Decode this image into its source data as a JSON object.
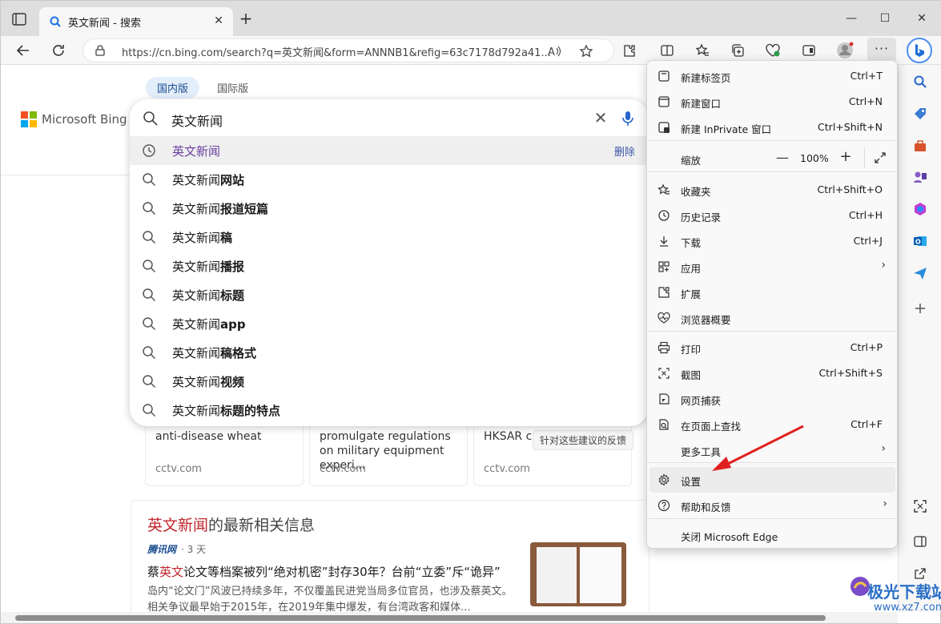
{
  "tab": {
    "title": "英文新闻 - 搜索"
  },
  "address": {
    "url": "https://cn.bing.com/search?q=英文新闻&form=ANNNB1&refig=63c7178d792a41..."
  },
  "page": {
    "scopes": [
      "国内版",
      "国际版"
    ],
    "brand": "Microsoft Bing",
    "search": {
      "query": "英文新闻",
      "suggestions": [
        {
          "prefix": "英文新闻",
          "suffix": "",
          "delete": "删除"
        },
        {
          "prefix": "英文新闻",
          "suffix": "网站"
        },
        {
          "prefix": "英文新闻",
          "suffix": "报道短篇"
        },
        {
          "prefix": "英文新闻",
          "suffix": "稿"
        },
        {
          "prefix": "英文新闻",
          "suffix": "播报"
        },
        {
          "prefix": "英文新闻",
          "suffix": "标题"
        },
        {
          "prefix": "英文新闻",
          "suffix": "app"
        },
        {
          "prefix": "英文新闻",
          "suffix": "稿格式"
        },
        {
          "prefix": "英文新闻",
          "suffix": "视频"
        },
        {
          "prefix": "英文新闻",
          "suffix": "标题的特点"
        }
      ]
    },
    "cards": [
      {
        "title": "anti-disease wheat",
        "source": "cctv.com"
      },
      {
        "title": "promulgate regulations on military equipment experi...",
        "source": "cctv.com"
      },
      {
        "title": "HKSAR c 19 caseloa",
        "source": "cctv.com"
      }
    ],
    "feedback": "针对这些建议的反馈",
    "news": {
      "heading_hl": "英文新闻",
      "heading_rest": "的最新相关信息",
      "source_logo": "腾讯网",
      "age": "· 3 天",
      "title_pre": "蔡",
      "title_hl": "英文",
      "title_post": "论文等档案被列“绝对机密”封存30年？台前“立委”斥“诡异”",
      "snippet": "岛内“论文门”风波已持续多年，不仅覆盖民进党当局多位官员，也涉及蔡英文。相关争议最早始于2015年，在2019年集中爆发，有台湾政客和媒体..."
    }
  },
  "menu": {
    "items": [
      {
        "label": "新建标签页",
        "shortcut": "Ctrl+T"
      },
      {
        "label": "新建窗口",
        "shortcut": "Ctrl+N"
      },
      {
        "label": "新建 InPrivate 窗口",
        "shortcut": "Ctrl+Shift+N"
      },
      {
        "label": "缩放",
        "zoom": "100%"
      },
      {
        "label": "收藏夹",
        "shortcut": "Ctrl+Shift+O"
      },
      {
        "label": "历史记录",
        "shortcut": "Ctrl+H"
      },
      {
        "label": "下载",
        "shortcut": "Ctrl+J"
      },
      {
        "label": "应用"
      },
      {
        "label": "扩展"
      },
      {
        "label": "浏览器概要"
      },
      {
        "label": "打印",
        "shortcut": "Ctrl+P"
      },
      {
        "label": "截图",
        "shortcut": "Ctrl+Shift+S"
      },
      {
        "label": "网页捕获"
      },
      {
        "label": "在页面上查找",
        "shortcut": "Ctrl+F"
      },
      {
        "label": "更多工具"
      },
      {
        "label": "设置"
      },
      {
        "label": "帮助和反馈"
      },
      {
        "label": "关闭 Microsoft Edge"
      }
    ]
  },
  "watermark": {
    "text": "极光下载站",
    "url": "www.xz7.com"
  },
  "colors": {
    "accent": "#0b57d0",
    "highlight": "#c0262d",
    "annotation": "#e02020"
  }
}
